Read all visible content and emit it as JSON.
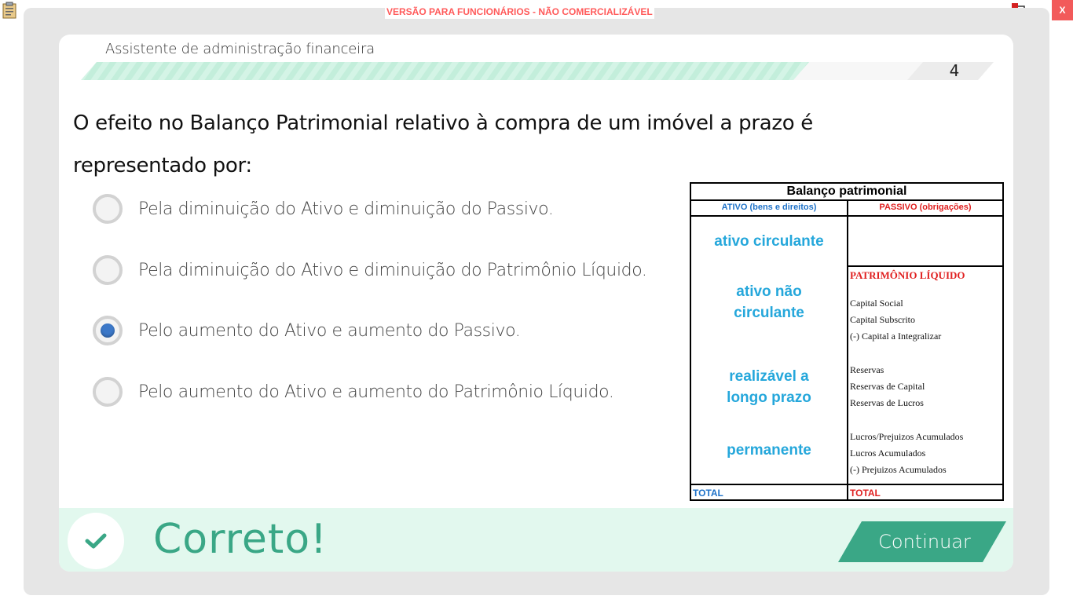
{
  "window": {
    "watermark": "VERSÃO PARA FUNCIONÁRIOS - NÃO COMERCIALIZÁVEL",
    "close_label": "X",
    "left_icon": "clipboard-icon",
    "right_icon": "network-status-icon"
  },
  "header": {
    "course_title": "Assistente de administração financeira",
    "page_number": "4"
  },
  "question": {
    "text": "O efeito no Balanço Patrimonial relativo à compra de um imóvel a prazo é representado por:"
  },
  "options": [
    {
      "label": "Pela diminuição do Ativo e diminuição do Passivo.",
      "selected": false
    },
    {
      "label": "Pela diminuição do Ativo e diminuição do Patrimônio Líquido.",
      "selected": false
    },
    {
      "label": "Pelo aumento do Ativo e aumento do Passivo.",
      "selected": true
    },
    {
      "label": "Pelo aumento do Ativo e aumento do Patrimônio Líquido.",
      "selected": false
    }
  ],
  "balance_sheet": {
    "title": "Balanço patrimonial",
    "ativo_header": "ATIVO (bens e direitos)",
    "passivo_header": "PASSIVO (obrigações)",
    "ativo_groups": [
      "ativo circulante",
      "ativo não circulante",
      "realizável a longo prazo",
      "permanente"
    ],
    "pl_title": "PATRIMÔNIO LÍQUIDO",
    "pl_lines": [
      "Capital Social",
      "Capital Subscrito",
      "(-) Capital a Integralizar",
      "Reservas",
      "Reservas de Capital",
      "Reservas de Lucros",
      "Lucros/Prejuizos Acumulados",
      "Lucros Acumulados",
      "(-) Prejuizos Acumulados"
    ],
    "total_left": "TOTAL",
    "total_right": "TOTAL"
  },
  "feedback": {
    "text": "Correto!",
    "icon": "checkmark-icon",
    "continue_label": "Continuar"
  },
  "colors": {
    "accent_green": "#3aa786",
    "feedback_bg": "#e2f8ee",
    "radio_selected": "#3c78c8",
    "watermark_red": "#ff5a5a"
  }
}
